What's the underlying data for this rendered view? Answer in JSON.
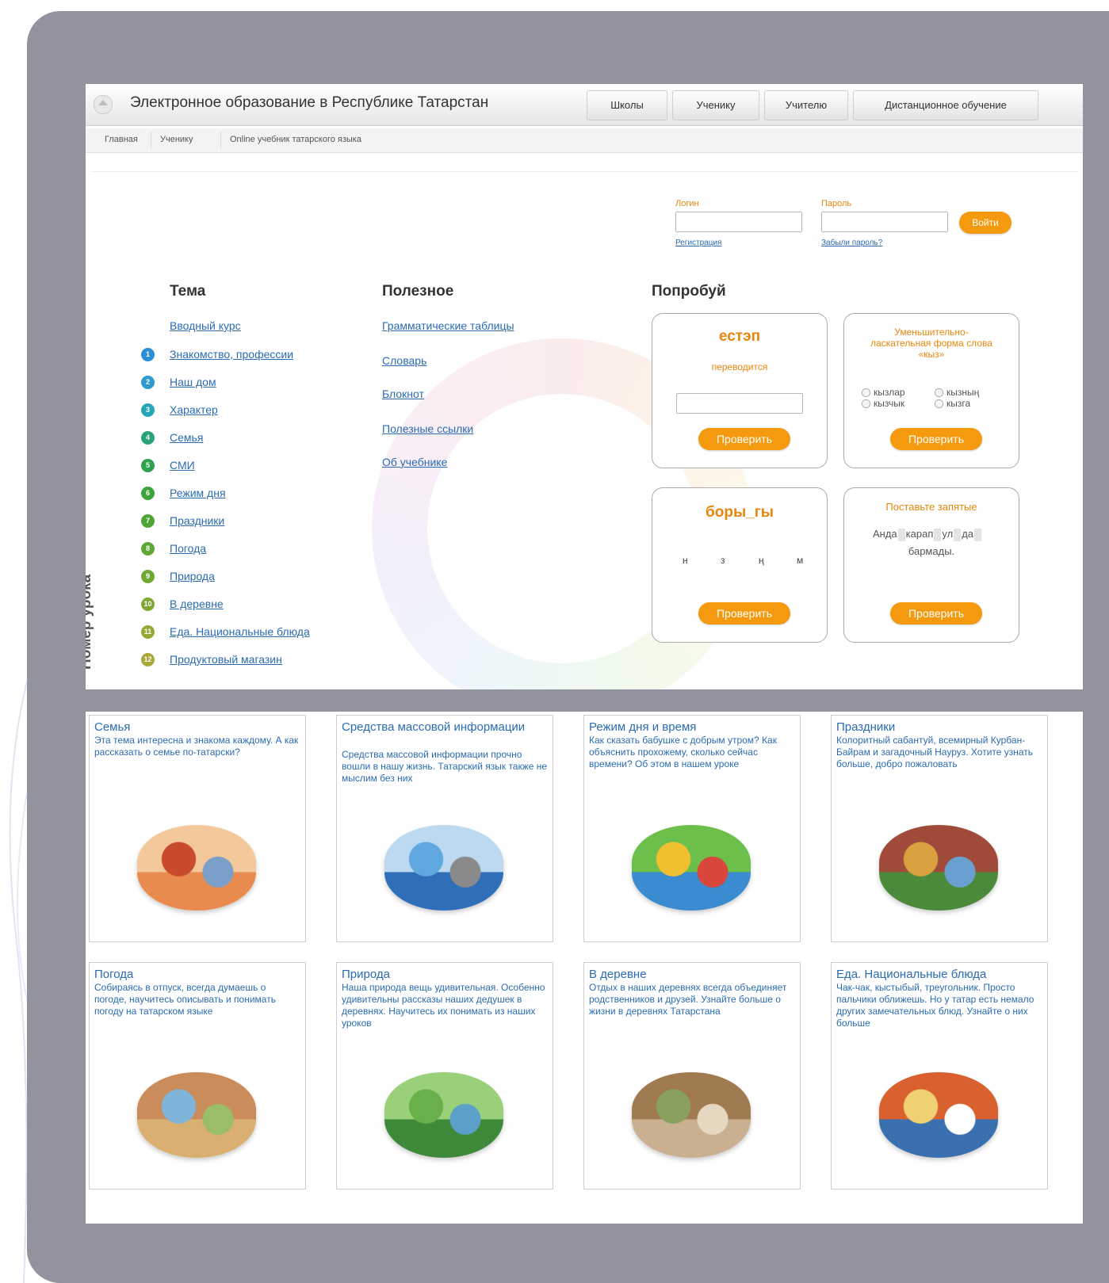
{
  "header": {
    "title": "Электронное образование в Республике Татарстан",
    "nav": [
      "Школы",
      "Ученику",
      "Учителю",
      "Дистанционное обучение"
    ]
  },
  "breadcrumb": [
    "Главная",
    "Ученику",
    "Online учебник татарского языка"
  ],
  "login": {
    "login_label": "Логин",
    "password_label": "Пароль",
    "submit": "Войти",
    "register": "Регистрация",
    "forgot": "Забыли пароль?"
  },
  "topics": {
    "heading": "Тема",
    "side_label": "Номер урока",
    "intro": "Вводный курс",
    "items": [
      {
        "num": "1",
        "label": "Знакомство, профессии",
        "color": "#2b8fd6"
      },
      {
        "num": "2",
        "label": "Наш дом",
        "color": "#2b9ad0"
      },
      {
        "num": "3",
        "label": "Характер",
        "color": "#26a6b8"
      },
      {
        "num": "4",
        "label": "Семья",
        "color": "#2aa37a"
      },
      {
        "num": "5",
        "label": "СМИ",
        "color": "#2fa24f"
      },
      {
        "num": "6",
        "label": "Режим дня",
        "color": "#3ca43a"
      },
      {
        "num": "7",
        "label": "Праздники",
        "color": "#4ea536"
      },
      {
        "num": "8",
        "label": "Погода",
        "color": "#5fa634"
      },
      {
        "num": "9",
        "label": "Природа",
        "color": "#6ea833"
      },
      {
        "num": "10",
        "label": "В деревне",
        "color": "#7fa933"
      },
      {
        "num": "11",
        "label": "Еда. Национальные блюда",
        "color": "#95aa35"
      },
      {
        "num": "12",
        "label": "Продуктовый магазин",
        "color": "#a8a838"
      }
    ]
  },
  "useful": {
    "heading": "Полезное",
    "items": [
      "Грамматические таблицы",
      "Словарь",
      "Блокнот",
      "Полезные ссылки",
      "Об учебнике"
    ]
  },
  "try": {
    "heading": "Попробуй",
    "check_label": "Проверить",
    "box1": {
      "word": "естэп",
      "sub": "переводится"
    },
    "box2": {
      "title": "Уменьшительно-ласкательная форма слова «кыз»",
      "options": [
        "кызлар",
        "кызның",
        "кызчык",
        "кызга"
      ]
    },
    "box3": {
      "word": "боры_гы",
      "letters": [
        "н",
        "з",
        "ң",
        "м"
      ]
    },
    "box4": {
      "title": "Поставьте запятые",
      "line1_a": "Анда",
      "line1_b": "карап",
      "line1_c": "ул",
      "line1_d": "да",
      "line2": "бармады."
    }
  },
  "cards": [
    {
      "title": "Семья",
      "text": "Эта тема интересна и знакома каждому. А как рассказать о семье по-татарски?",
      "pic": "family-illustration"
    },
    {
      "title": "Средства массовой информации",
      "text": "Средства массовой информации прочно вошли в нашу жизнь. Татарский язык также не мыслим без них",
      "pic": "globe-illustration"
    },
    {
      "title": "Режим дня и время",
      "text": "Как сказать бабушке с добрым утром? Как объяснить прохожему, сколько сейчас времени? Об этом в нашем уроке",
      "pic": "clock-illustration"
    },
    {
      "title": "Праздники",
      "text": "Колоритный сабантуй, всемирный Курбан-Байрам и загадочный Науруз. Хотите узнать больше, добро пожаловать",
      "pic": "holiday-illustration"
    },
    {
      "title": "Погода",
      "text": "Собираясь в отпуск, всегда думаешь о погоде, научитесь описывать и понимать погоду на татарском языке",
      "pic": "weather-illustration"
    },
    {
      "title": "Природа",
      "text": "Наша природа вещь удивительная. Особенно удивительны рассказы наших дедушек в деревнях. Научитесь их понимать из наших уроков",
      "pic": "nature-illustration"
    },
    {
      "title": "В деревне",
      "text": "Отдых в наших деревнях всегда объединяет родственников и друзей. Узнайте больше о жизни в деревнях Татарстана",
      "pic": "village-illustration"
    },
    {
      "title": "Еда. Национальные блюда",
      "text": "Чак-чак, кыстыбый, треугольник. Просто пальчики оближешь. Но у татар есть немало других замечательных блюд. Узнайте о них больше",
      "pic": "food-illustration"
    }
  ],
  "colors": {
    "accent": "#f59a0f",
    "link": "#2a6bb3",
    "panel": "#93929f"
  }
}
